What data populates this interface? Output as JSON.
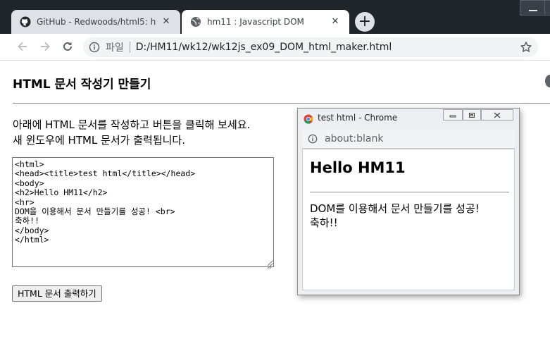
{
  "browser": {
    "tabs": [
      {
        "title": "GitHub - Redwoods/html5: html",
        "icon": "github-icon",
        "active": false,
        "close": "✕"
      },
      {
        "title": "hm11 : Javascript DOM",
        "icon": "globe-icon",
        "active": true,
        "close": "✕"
      }
    ],
    "new_tab_label": "+",
    "address": {
      "scheme": "파일",
      "url": "D:/HM11/wk12/wk12js_ex09_DOM_html_maker.html"
    }
  },
  "page": {
    "title": "HTML 문서 작성기 만들기",
    "description_line1": "아래에 HTML 문서를 작성하고 버튼을 클릭해 보세요.",
    "description_line2": "새 윈도우에 HTML 문서가 출력됩니다.",
    "textarea_value": "<html>\n<head><title>test html</title></head>\n<body>\n<h2>Hello HM11</h2>\n<hr>\nDOM을 이용해서 문서 만들기를 성공! <br>\n축하!!\n</body>\n</html>",
    "button_label": "HTML 문서 출력하기"
  },
  "popup": {
    "window_title": "test html - Chrome",
    "address": "about:blank",
    "heading": "Hello HM11",
    "text_line1": "DOM를 이용해서 문서 만들기를 성공!",
    "text_line2": "축하!!"
  }
}
